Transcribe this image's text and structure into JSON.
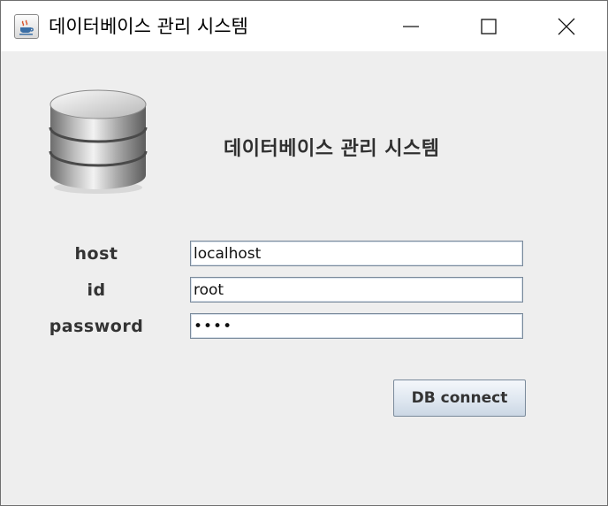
{
  "window": {
    "title": "데이터베이스 관리 시스템",
    "app_icon": "java-cup-icon",
    "controls": [
      "minimize-icon",
      "maximize-icon",
      "close-icon"
    ]
  },
  "logo": {
    "icon": "database-icon"
  },
  "heading": "데이터베이스 관리 시스템",
  "form": {
    "host": {
      "label": "host",
      "value": "localhost"
    },
    "id": {
      "label": "id",
      "value": "root"
    },
    "password": {
      "label": "password",
      "value": "••••"
    }
  },
  "connect_button": {
    "label": "DB connect"
  },
  "colors": {
    "background": "#eeeeee",
    "titlebar": "#ffffff",
    "field_border": "#7a8a9b",
    "button_top": "#f4f7fb",
    "button_bottom": "#cbd7e4"
  }
}
